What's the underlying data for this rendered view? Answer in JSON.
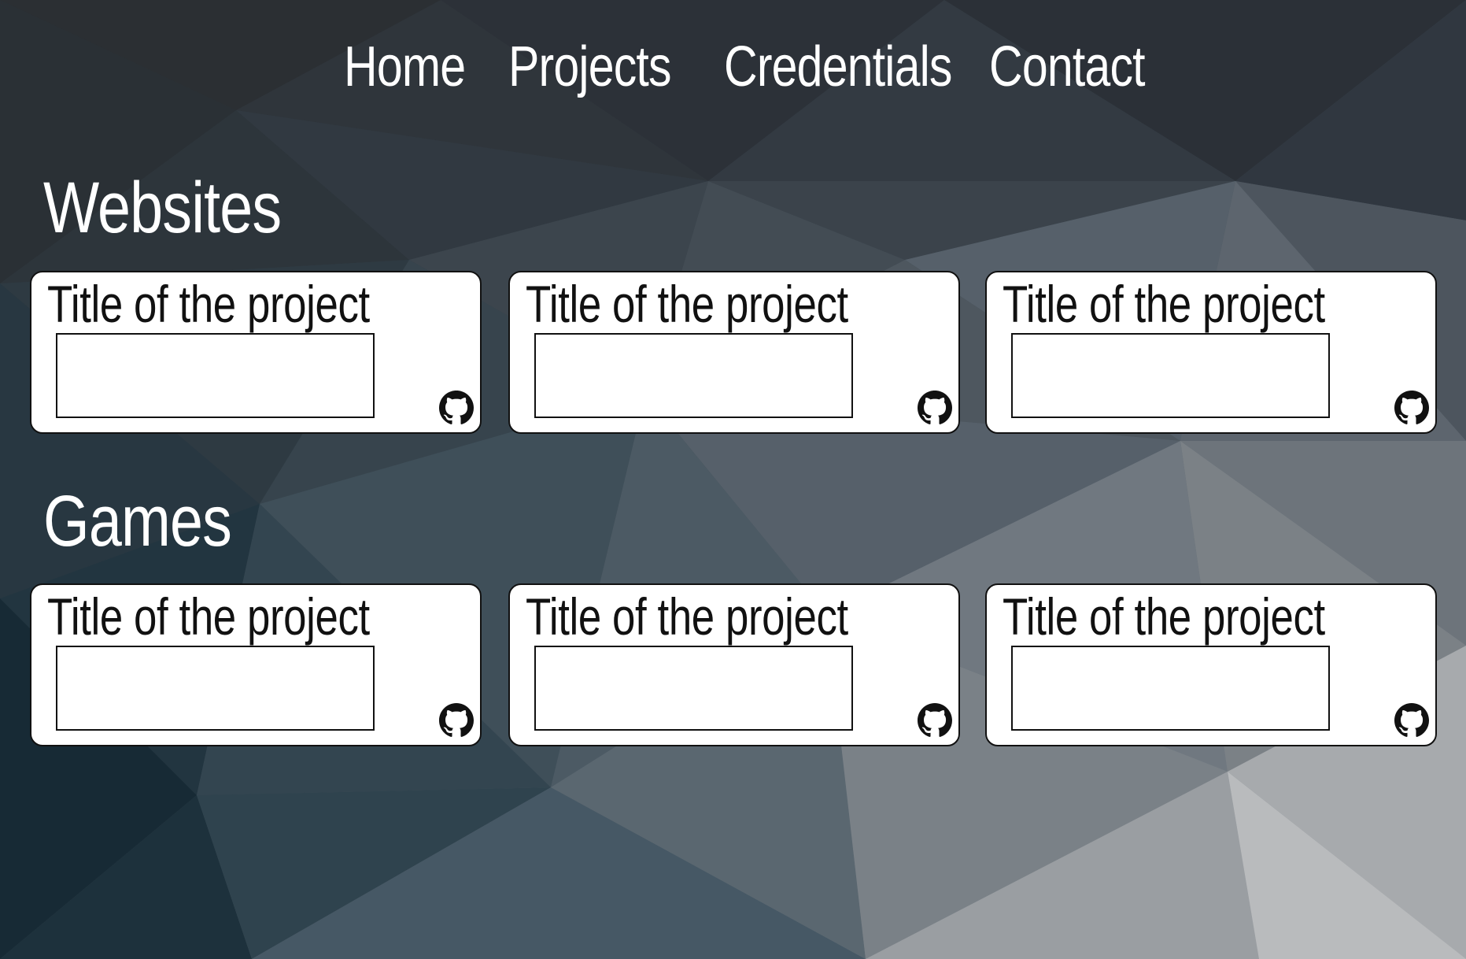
{
  "nav": {
    "items": [
      {
        "label": "Home"
      },
      {
        "label": "Projects"
      },
      {
        "label": "Credentials"
      },
      {
        "label": "Contact"
      }
    ]
  },
  "sections": [
    {
      "title": "Websites",
      "cards": [
        {
          "title": "Title of the project",
          "icon": "github-icon"
        },
        {
          "title": "Title of the project",
          "icon": "github-icon"
        },
        {
          "title": "Title of the project",
          "icon": "github-icon"
        }
      ]
    },
    {
      "title": "Games",
      "cards": [
        {
          "title": "Title of the project",
          "icon": "github-icon"
        },
        {
          "title": "Title of the project",
          "icon": "github-icon"
        },
        {
          "title": "Title of the project",
          "icon": "github-icon"
        }
      ]
    }
  ],
  "colors": {
    "background_dark": "#1a2a34",
    "background_light": "#bfc1c3",
    "card_background": "#ffffff",
    "text_light": "#ffffff",
    "text_dark": "#111111"
  }
}
